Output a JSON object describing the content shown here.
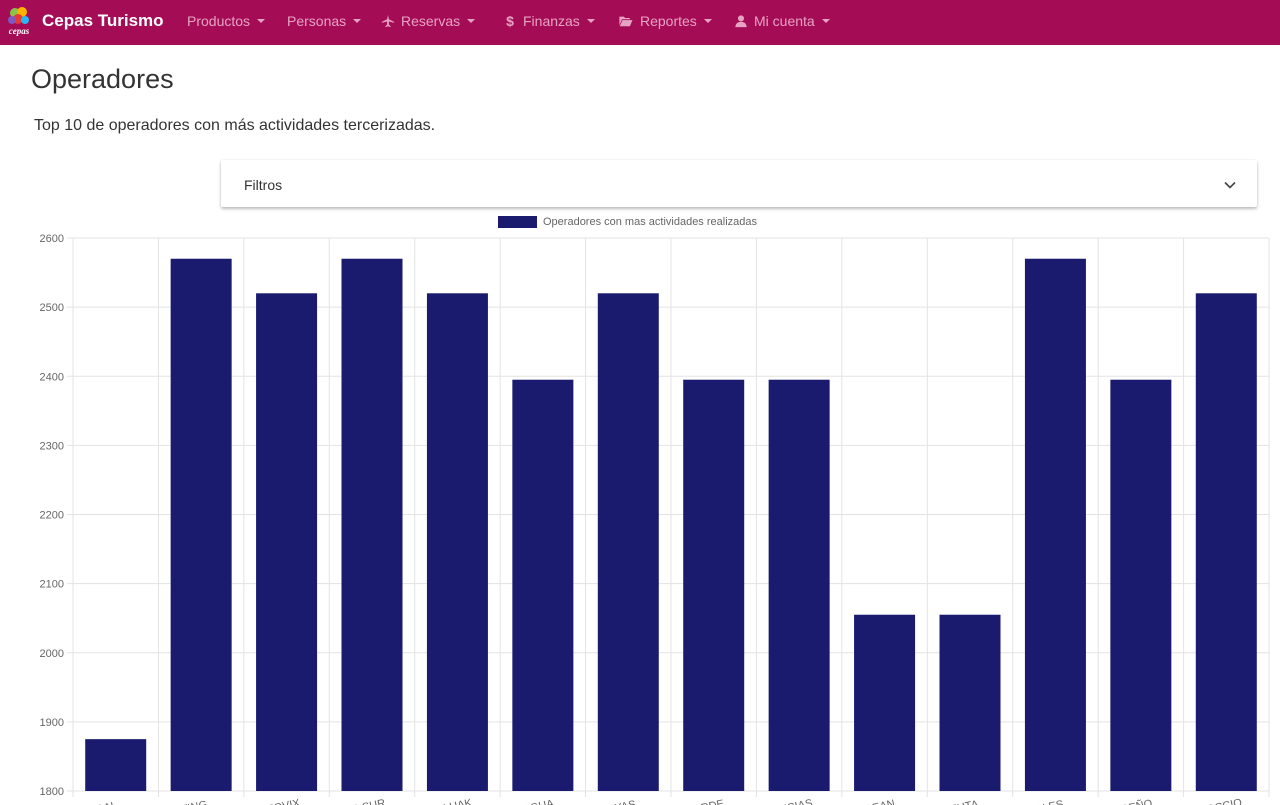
{
  "navbar": {
    "logo_text": "cepas",
    "brand": "Cepas Turismo",
    "items": [
      {
        "label": "Productos",
        "icon": ""
      },
      {
        "label": "Personas",
        "icon": ""
      },
      {
        "label": "Reservas",
        "icon": "airplane-icon"
      },
      {
        "label": "Finanzas",
        "icon": "dollar-icon"
      },
      {
        "label": "Reportes",
        "icon": "folder-open-icon"
      },
      {
        "label": "Mi cuenta",
        "icon": "user-icon"
      }
    ]
  },
  "page": {
    "title": "Operadores",
    "subtitle": "Top 10 de operadores con más actividades tercerizadas."
  },
  "filters": {
    "label": "Filtros",
    "icon": "chevron-down-icon"
  },
  "colors": {
    "navbar": "#a50c56",
    "bar": "#1a1a6e",
    "nav_text": "#e7a3c3"
  },
  "chart_data": {
    "type": "bar",
    "legend": "Operadores con mas actividades realizadas",
    "legend_position": "top",
    "grid": true,
    "categories": [
      "...RAL",
      "...TING",
      "...EOVIX",
      "...S SUR",
      "...LLUAK",
      "...AGUA",
      "...AYAS",
      "...ARDE",
      "...NCIAS",
      "...DEAN",
      "...EUTA",
      "...ALES",
      "...REÑO",
      "...OCCIO"
    ],
    "values": [
      1875,
      2570,
      2520,
      2570,
      2520,
      2395,
      2520,
      2395,
      2395,
      2055,
      2055,
      2570,
      2395,
      2520
    ],
    "ylim": [
      1800,
      2600
    ],
    "yticks": [
      1800,
      1900,
      2000,
      2100,
      2200,
      2300,
      2400,
      2500,
      2600
    ]
  }
}
